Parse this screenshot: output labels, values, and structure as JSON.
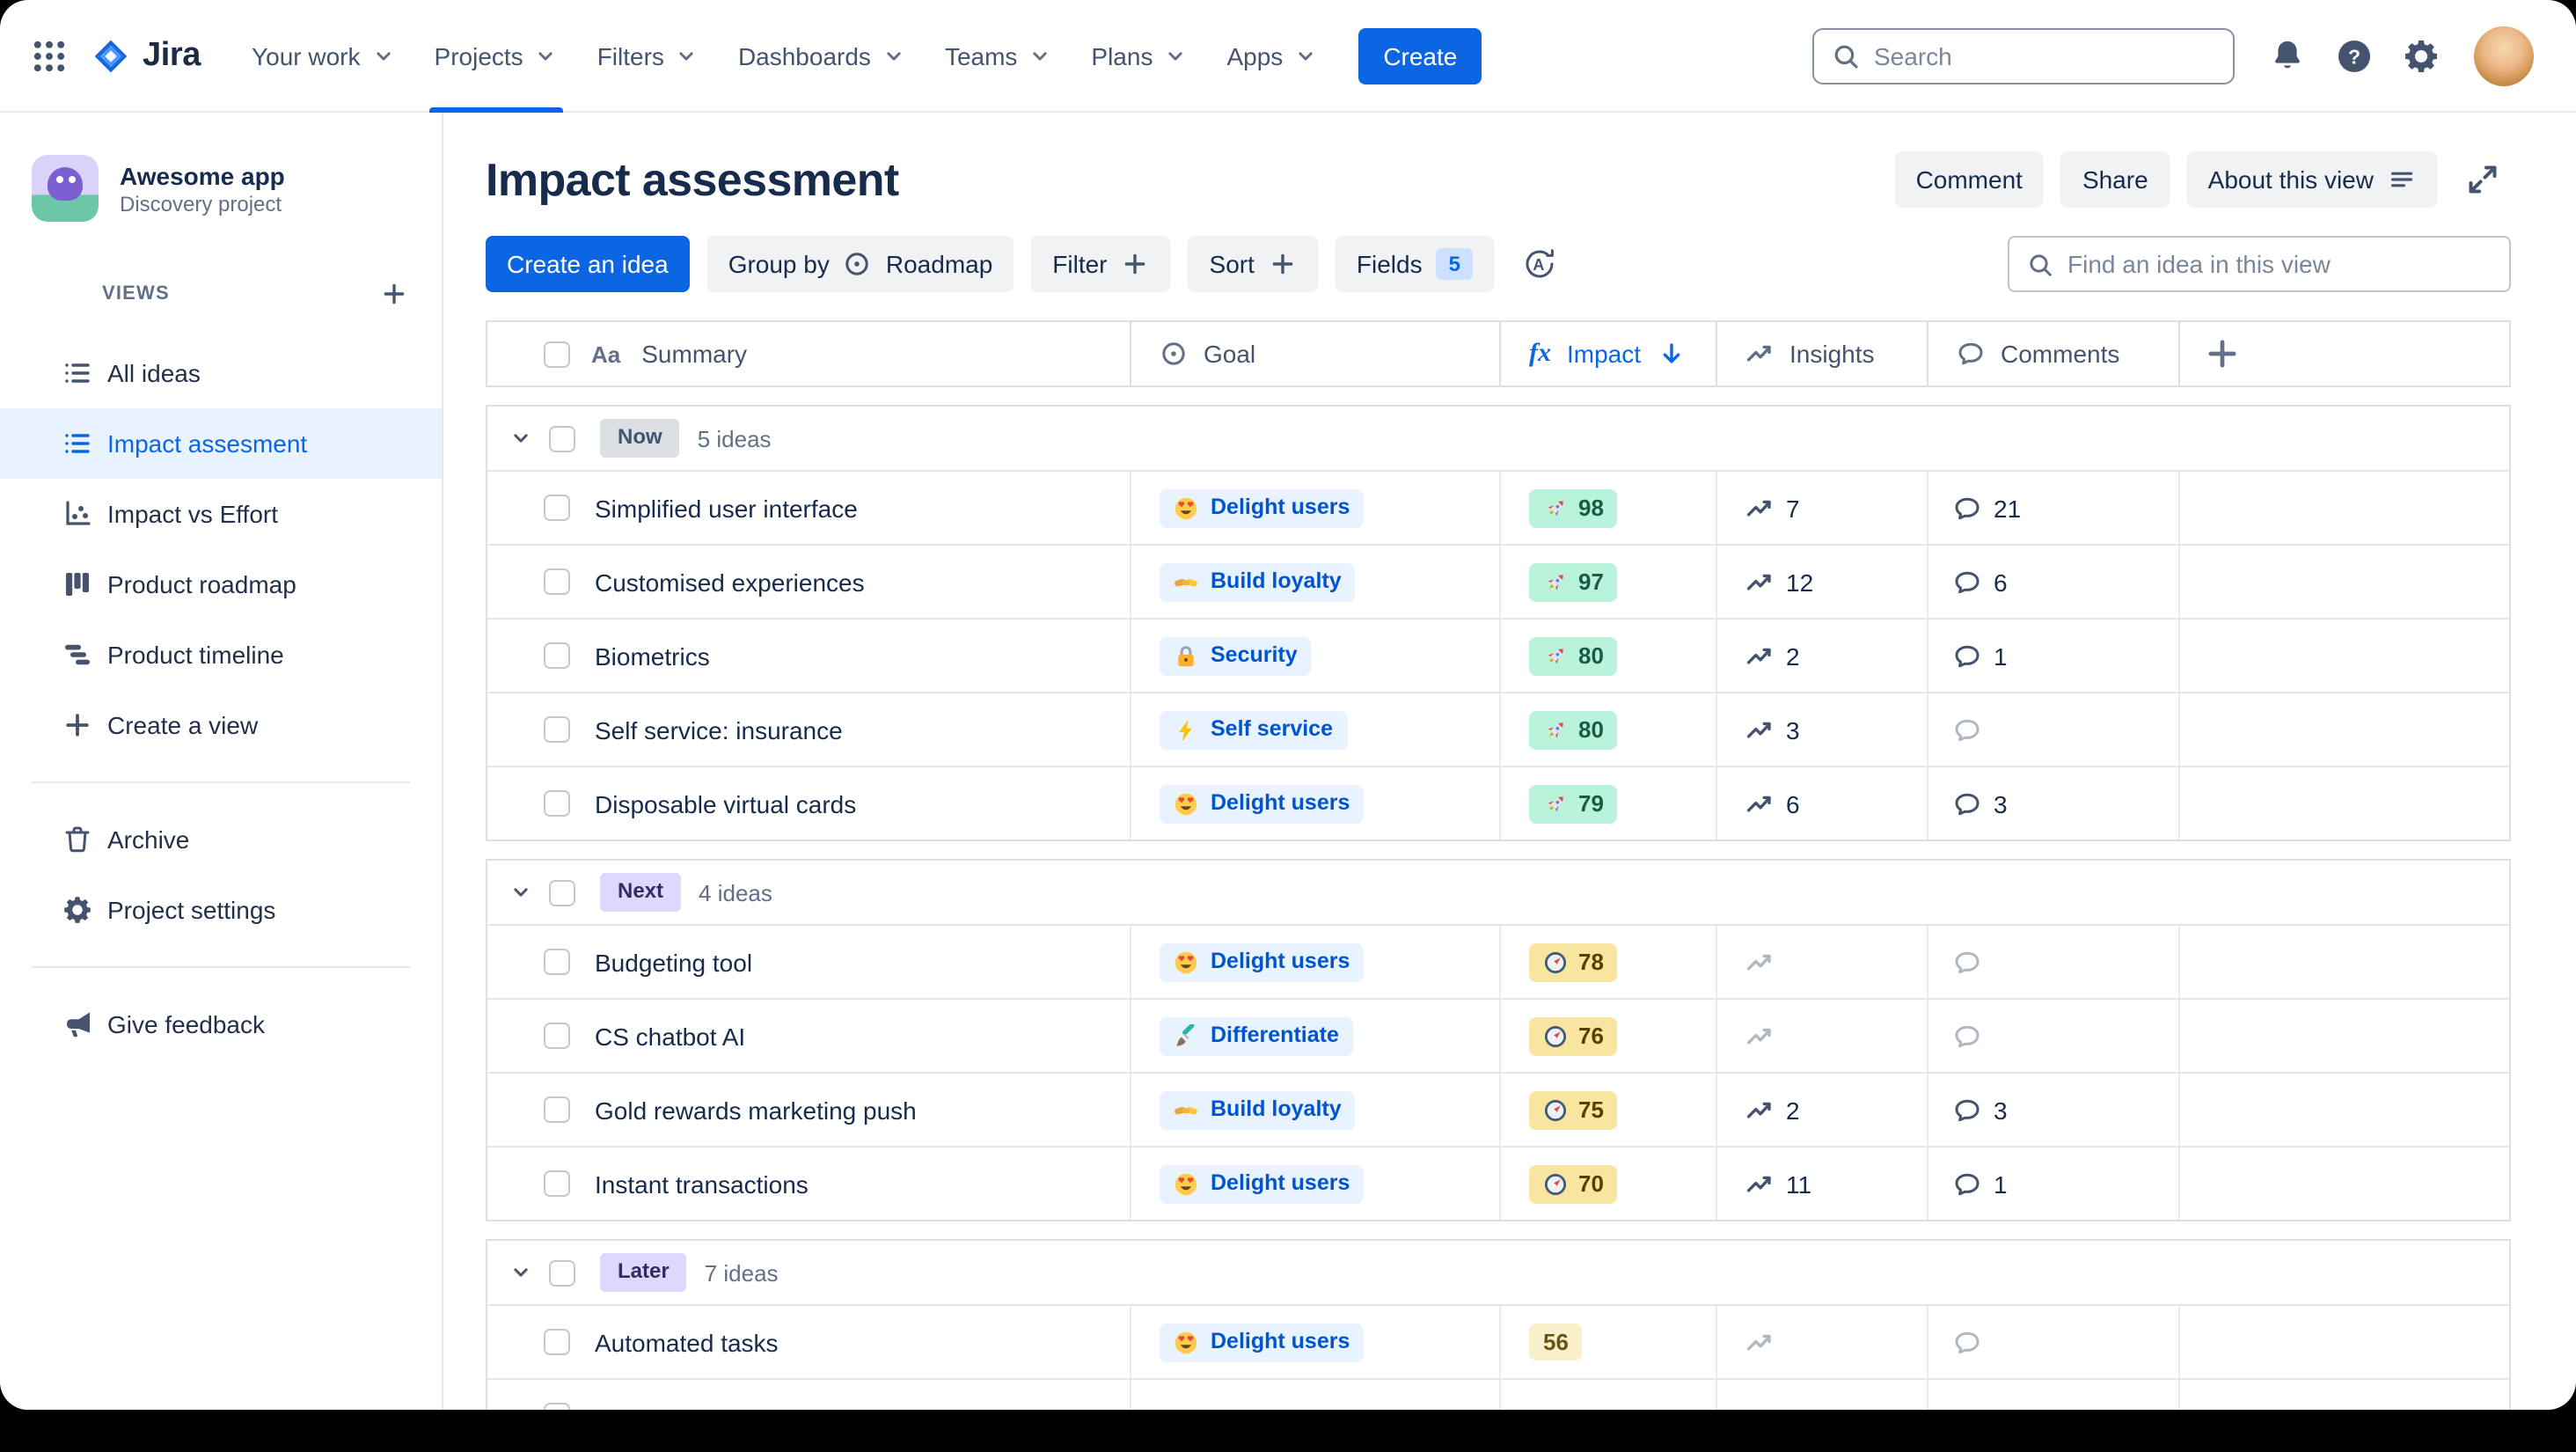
{
  "colors": {
    "accent_blue": "#0C66E4",
    "selected_bg": "#E9F2FF",
    "text_dark": "#172B4D",
    "text_medium": "#44546F",
    "border": "#DCDFE4",
    "impact_high_bg": "#BAF3DB",
    "impact_medium_bg": "#F8E6A0",
    "impact_low_bg": "#FBF0CC",
    "goal_chip_bg": "#E9F2FF",
    "goal_chip_text": "#0055CC"
  },
  "topnav": {
    "logo_text": "Jira",
    "items": [
      {
        "label": "Your work"
      },
      {
        "label": "Projects",
        "active": true
      },
      {
        "label": "Filters"
      },
      {
        "label": "Dashboards"
      },
      {
        "label": "Teams"
      },
      {
        "label": "Plans"
      },
      {
        "label": "Apps"
      }
    ],
    "create_label": "Create",
    "search_placeholder": "Search"
  },
  "sidebar": {
    "project_name": "Awesome app",
    "project_type": "Discovery project",
    "views_label": "VIEWS",
    "items": [
      {
        "label": "All ideas",
        "icon": "list"
      },
      {
        "label": "Impact assesment",
        "icon": "list",
        "active": true
      },
      {
        "label": "Impact vs Effort",
        "icon": "scatter"
      },
      {
        "label": "Product roadmap",
        "icon": "board"
      },
      {
        "label": "Product timeline",
        "icon": "timeline"
      },
      {
        "label": "Create a view",
        "icon": "plus"
      }
    ],
    "footer_items": [
      {
        "label": "Archive",
        "icon": "trash"
      },
      {
        "label": "Project settings",
        "icon": "gear"
      }
    ],
    "feedback_label": "Give feedback"
  },
  "view_header": {
    "title": "Impact assessment",
    "comment_label": "Comment",
    "share_label": "Share",
    "about_label": "About this view"
  },
  "toolbar": {
    "create_idea_label": "Create an idea",
    "group_by_label": "Group by",
    "group_by_value": "Roadmap",
    "filter_label": "Filter",
    "sort_label": "Sort",
    "fields_label": "Fields",
    "fields_count": "5",
    "find_placeholder": "Find an idea in this view"
  },
  "table": {
    "columns": [
      {
        "label": "Summary",
        "icon_text": "Aa"
      },
      {
        "label": "Goal",
        "icon": "target"
      },
      {
        "label": "Impact",
        "icon_text": "fx",
        "sorted": "descending"
      },
      {
        "label": "Insights",
        "icon": "trend"
      },
      {
        "label": "Comments",
        "icon": "comment"
      }
    ],
    "groups": [
      {
        "label": "Now",
        "count": "5 ideas",
        "chip_bg": "#DCDFE4",
        "chip_text": "#44546F",
        "rows": [
          {
            "summary": "Simplified user interface",
            "goal": "Delight users",
            "goal_icon": "heart-eyes",
            "impact": "98",
            "impact_tier": "high",
            "impact_icon": "rocket",
            "insights": "7",
            "comments": "21"
          },
          {
            "summary": "Customised experiences",
            "goal": "Build loyalty",
            "goal_icon": "handshake",
            "impact": "97",
            "impact_tier": "high",
            "impact_icon": "rocket",
            "insights": "12",
            "comments": "6"
          },
          {
            "summary": "Biometrics",
            "goal": "Security",
            "goal_icon": "lock",
            "impact": "80",
            "impact_tier": "high",
            "impact_icon": "rocket",
            "insights": "2",
            "comments": "1"
          },
          {
            "summary": "Self service: insurance",
            "goal": "Self service",
            "goal_icon": "bolt",
            "impact": "80",
            "impact_tier": "high",
            "impact_icon": "rocket",
            "insights": "3",
            "comments": ""
          },
          {
            "summary": "Disposable virtual cards",
            "goal": "Delight users",
            "goal_icon": "heart-eyes",
            "impact": "79",
            "impact_tier": "high",
            "impact_icon": "rocket",
            "insights": "6",
            "comments": "3"
          }
        ]
      },
      {
        "label": "Next",
        "count": "4 ideas",
        "chip_bg": "#DFD8FD",
        "chip_text": "#352C63",
        "rows": [
          {
            "summary": "Budgeting tool",
            "goal": "Delight users",
            "goal_icon": "heart-eyes",
            "impact": "78",
            "impact_tier": "medium",
            "impact_icon": "compass",
            "insights": "",
            "comments": ""
          },
          {
            "summary": "CS chatbot AI",
            "goal": "Differentiate",
            "goal_icon": "brush",
            "impact": "76",
            "impact_tier": "medium",
            "impact_icon": "compass",
            "insights": "",
            "comments": ""
          },
          {
            "summary": "Gold rewards marketing push",
            "goal": "Build loyalty",
            "goal_icon": "handshake",
            "impact": "75",
            "impact_tier": "medium",
            "impact_icon": "compass",
            "insights": "2",
            "comments": "3"
          },
          {
            "summary": "Instant transactions",
            "goal": "Delight users",
            "goal_icon": "heart-eyes",
            "impact": "70",
            "impact_tier": "medium",
            "impact_icon": "compass",
            "insights": "11",
            "comments": "1"
          }
        ]
      },
      {
        "label": "Later",
        "count": "7 ideas",
        "chip_bg": "#DFD8FD",
        "chip_text": "#352C63",
        "rows": [
          {
            "summary": "Automated tasks",
            "goal": "Delight users",
            "goal_icon": "heart-eyes",
            "impact": "56",
            "impact_tier": "low",
            "impact_icon": null,
            "insights": "",
            "comments": ""
          },
          {
            "summary": null,
            "goal": null,
            "goal_icon": null,
            "impact": null,
            "impact_tier": null,
            "impact_icon": null,
            "insights": null,
            "comments": null,
            "partial": true
          }
        ]
      }
    ]
  }
}
